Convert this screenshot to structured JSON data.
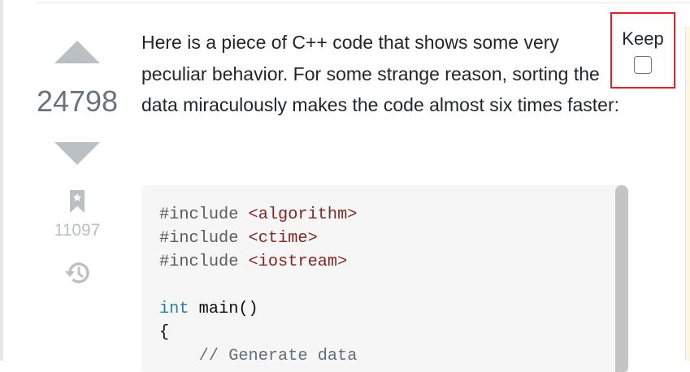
{
  "question": {
    "vote_count": "24798",
    "bookmark_count": "11097",
    "body": "Here is a piece of C++ code that shows some very peculiar behavior. For some strange reason, sorting the data miraculously makes the code almost six times faster:",
    "code_lines": [
      {
        "pp": "#include ",
        "st": "<algorithm>"
      },
      {
        "pp": "#include ",
        "st": "<ctime>"
      },
      {
        "pp": "#include ",
        "st": "<iostream>"
      },
      {
        "kw": "int",
        "rest": " main()"
      },
      {
        "rest": "{"
      },
      {
        "cm": "    // Generate data"
      }
    ]
  },
  "keep": {
    "label": "Keep",
    "checked": false
  },
  "colors": {
    "highlight_border": "#d9232e",
    "vote_arrow": "#bbc0c4",
    "code_bg": "#f6f6f6"
  }
}
